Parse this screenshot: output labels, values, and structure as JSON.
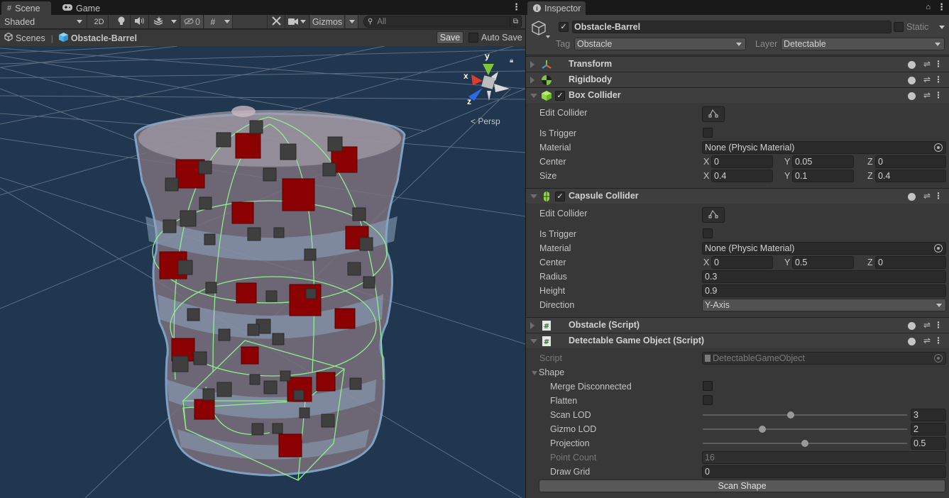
{
  "scene": {
    "tabs": [
      {
        "label": "Scene",
        "icon": "grid-hash-icon",
        "active": true
      },
      {
        "label": "Game",
        "icon": "gamepad-icon",
        "active": false
      }
    ],
    "toolbar": {
      "draw_mode": "Shaded",
      "mode_2d": "2D",
      "hidden_count": "0",
      "gizmos_label": "Gizmos",
      "search_placeholder": "All"
    },
    "breadcrumbs": {
      "root": "Scenes",
      "separator": "|",
      "current": "Obstacle-Barrel"
    },
    "save_label": "Save",
    "auto_save_label": "Auto Save",
    "auto_save_checked": false,
    "orientation_gizmo": {
      "x_label": "x",
      "y_label": "y",
      "z_label": "z",
      "projection_label": "Persp"
    },
    "colors": {
      "background": "#21364f",
      "grid": "#6b7b8c",
      "collider_wire": "#8ef08a",
      "red_point": "#8b0000",
      "gray_point": "#3f3f3f"
    }
  },
  "inspector": {
    "tab_label": "Inspector",
    "object": {
      "active": true,
      "name": "Obstacle-Barrel",
      "static_label": "Static",
      "static_checked": false,
      "tag_label": "Tag",
      "tag_value": "Obstacle",
      "layer_label": "Layer",
      "layer_value": "Detectable"
    },
    "components": {
      "transform": {
        "title": "Transform",
        "expanded": false
      },
      "rigidbody": {
        "title": "Rigidbody",
        "expanded": false
      },
      "box_collider": {
        "title": "Box Collider",
        "enabled": true,
        "expanded": true,
        "edit_collider_label": "Edit Collider",
        "is_trigger_label": "Is Trigger",
        "is_trigger": false,
        "material_label": "Material",
        "material_value": "None (Physic Material)",
        "center_label": "Center",
        "center": {
          "x": "0",
          "y": "0.05",
          "z": "0"
        },
        "size_label": "Size",
        "size": {
          "x": "0.4",
          "y": "0.1",
          "z": "0.4"
        }
      },
      "capsule_collider": {
        "title": "Capsule Collider",
        "enabled": true,
        "expanded": true,
        "edit_collider_label": "Edit Collider",
        "is_trigger_label": "Is Trigger",
        "is_trigger": false,
        "material_label": "Material",
        "material_value": "None (Physic Material)",
        "center_label": "Center",
        "center": {
          "x": "0",
          "y": "0.5",
          "z": "0"
        },
        "radius_label": "Radius",
        "radius": "0.3",
        "height_label": "Height",
        "height": "0.9",
        "direction_label": "Direction",
        "direction": "Y-Axis"
      },
      "obstacle_script": {
        "title": "Obstacle (Script)",
        "expanded": false
      },
      "detectable_script": {
        "title": "Detectable Game Object (Script)",
        "expanded": true,
        "script_label": "Script",
        "script_value": "DetectableGameObject",
        "shape_label": "Shape",
        "merge_label": "Merge Disconnected",
        "merge": false,
        "flatten_label": "Flatten",
        "flatten": false,
        "scan_lod_label": "Scan LOD",
        "scan_lod": "3",
        "scan_lod_fraction": 0.43,
        "gizmo_lod_label": "Gizmo LOD",
        "gizmo_lod": "2",
        "gizmo_lod_fraction": 0.29,
        "projection_label": "Projection",
        "projection": "0.5",
        "projection_fraction": 0.5,
        "point_count_label": "Point Count",
        "point_count": "16",
        "draw_grid_label": "Draw Grid",
        "draw_grid": "0",
        "scan_button": "Scan Shape"
      }
    },
    "axis_labels": {
      "x": "X",
      "y": "Y",
      "z": "Z"
    },
    "check_glyph": "✓"
  }
}
